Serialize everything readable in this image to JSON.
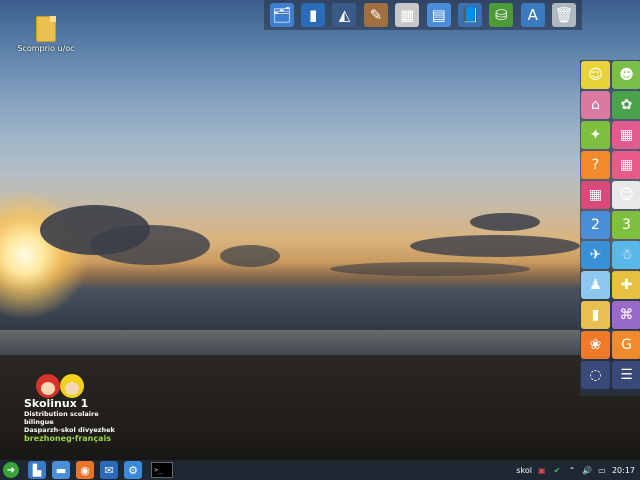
{
  "desktop": {
    "file_icon": {
      "label": "Scomprio u/oc",
      "icon": "folder-file-icon"
    }
  },
  "top_dock": [
    {
      "name": "file-manager-icon",
      "glyph": "🗂",
      "color": "#3f7fd0"
    },
    {
      "name": "document-icon",
      "glyph": "▮",
      "color": "#2b6cb8"
    },
    {
      "name": "vector-draw-icon",
      "glyph": "◭",
      "color": "#3a5a88"
    },
    {
      "name": "paint-brush-icon",
      "glyph": "✎",
      "color": "#a07040"
    },
    {
      "name": "calculator-icon",
      "glyph": "▦",
      "color": "#c8c8c8"
    },
    {
      "name": "writer-icon",
      "glyph": "▤",
      "color": "#4a8ed8"
    },
    {
      "name": "reader-icon",
      "glyph": "📘",
      "color": "#3a6fb0"
    },
    {
      "name": "network-icon",
      "glyph": "⛁",
      "color": "#4c9a38"
    },
    {
      "name": "font-tool-icon",
      "glyph": "A",
      "color": "#3a7ac0"
    },
    {
      "name": "trash-icon",
      "glyph": "🗑",
      "color": "#b0b8c0"
    }
  ],
  "right_panel": [
    {
      "name": "learning-app-1-icon",
      "glyph": "☺",
      "color": "#e8d43a"
    },
    {
      "name": "learning-app-2-icon",
      "glyph": "☻",
      "color": "#7bbf4a"
    },
    {
      "name": "learning-app-3-icon",
      "glyph": "⌂",
      "color": "#d97aa0"
    },
    {
      "name": "learning-app-4-icon",
      "glyph": "✿",
      "color": "#4aa24a"
    },
    {
      "name": "learning-app-5-icon",
      "glyph": "✦",
      "color": "#7fbf3f"
    },
    {
      "name": "learning-app-6-icon",
      "glyph": "▦",
      "color": "#e05c8e"
    },
    {
      "name": "learning-app-7-icon",
      "glyph": "?",
      "color": "#f08a2a"
    },
    {
      "name": "learning-app-8-icon",
      "glyph": "▦",
      "color": "#e85a8a"
    },
    {
      "name": "learning-app-9-icon",
      "glyph": "▦",
      "color": "#d84a7a"
    },
    {
      "name": "learning-app-10-icon",
      "glyph": "☺",
      "color": "#e8e8e8"
    },
    {
      "name": "learning-app-11-icon",
      "glyph": "2",
      "color": "#4a8ed8"
    },
    {
      "name": "learning-app-12-icon",
      "glyph": "3",
      "color": "#7fbf3f"
    },
    {
      "name": "learning-app-13-icon",
      "glyph": "✈",
      "color": "#3a90d8"
    },
    {
      "name": "learning-app-14-icon",
      "glyph": "☃",
      "color": "#58b8e8"
    },
    {
      "name": "learning-app-15-icon",
      "glyph": "♟",
      "color": "#8cc8f0"
    },
    {
      "name": "learning-app-16-icon",
      "glyph": "✚",
      "color": "#e8c040"
    },
    {
      "name": "learning-app-17-icon",
      "glyph": "▮",
      "color": "#e8c050"
    },
    {
      "name": "learning-app-18-icon",
      "glyph": "⌘",
      "color": "#9a6ac8"
    },
    {
      "name": "tux-paint-icon",
      "glyph": "❀",
      "color": "#f07a2a"
    },
    {
      "name": "gcompris-icon",
      "glyph": "G",
      "color": "#f08a2a"
    },
    {
      "name": "circle-menu-icon",
      "glyph": "◌",
      "color": "#3a4a78"
    },
    {
      "name": "list-menu-icon",
      "glyph": "☰",
      "color": "#3a4a78"
    }
  ],
  "logo": {
    "title": "Skolinux 1",
    "line1": "Distribution scolaire bilingue",
    "line2": "Dasparzh-skol divyezhek",
    "lang_left": "brezhoneg",
    "lang_sep": "·",
    "lang_right": "français"
  },
  "taskbar": {
    "launchers": [
      {
        "name": "files-icon",
        "glyph": "▙",
        "color": "#3a7ac8"
      },
      {
        "name": "folder-icon",
        "glyph": "▬",
        "color": "#4a8ed8"
      },
      {
        "name": "firefox-icon",
        "glyph": "◉",
        "color": "#e8742a"
      },
      {
        "name": "mail-icon",
        "glyph": "✉",
        "color": "#2a6ab8"
      },
      {
        "name": "settings-icon",
        "glyph": "⚙",
        "color": "#3a8ad8"
      }
    ],
    "terminal_text": ">_",
    "user": "skol",
    "clock": "20:17"
  }
}
